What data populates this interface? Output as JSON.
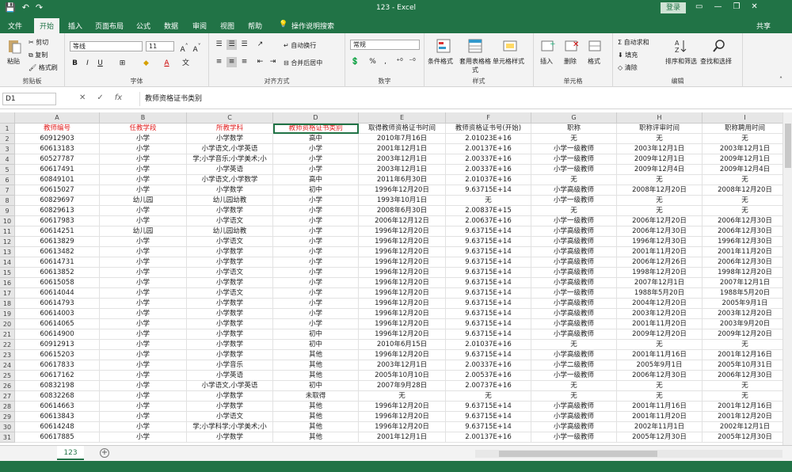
{
  "window": {
    "title": "123 - Excel",
    "login": "登录",
    "share": "共享"
  },
  "tabs": [
    "文件",
    "开始",
    "插入",
    "页面布局",
    "公式",
    "数据",
    "审阅",
    "视图",
    "帮助",
    "操作说明搜索"
  ],
  "ribbon": {
    "clipboard": {
      "paste": "粘贴",
      "cut": "剪切",
      "copy": "复制",
      "format_painter": "格式刷",
      "label": "剪贴板"
    },
    "font": {
      "name": "等线",
      "size": "11",
      "label": "字体"
    },
    "align": {
      "wrap": "自动换行",
      "merge": "合并后居中",
      "label": "对齐方式"
    },
    "number": {
      "format": "常规",
      "label": "数字"
    },
    "styles": {
      "cond": "条件格式",
      "table": "套用表格格式",
      "cell": "单元格样式",
      "label": "样式"
    },
    "cells": {
      "insert": "插入",
      "delete": "删除",
      "format": "格式",
      "label": "单元格"
    },
    "editing": {
      "autosum": "自动求和",
      "fill": "填充",
      "clear": "清除",
      "sort": "排序和筛选",
      "find": "查找和选择",
      "label": "编辑"
    }
  },
  "formula": {
    "namebox": "D1",
    "content": "教师资格证书类别"
  },
  "columns": [
    "A",
    "B",
    "C",
    "D",
    "E",
    "F",
    "G",
    "H",
    "I"
  ],
  "row_numbers": [
    "1",
    "2",
    "3",
    "4",
    "5",
    "6",
    "7",
    "8",
    "9",
    "10",
    "11",
    "12",
    "13",
    "14",
    "15",
    "16",
    "17",
    "18",
    "19",
    "20",
    "21",
    "22",
    "23",
    "24",
    "25",
    "26",
    "27",
    "28",
    "29",
    "30",
    "31"
  ],
  "rows": [
    [
      "教师编号",
      "任教学段",
      "所教学科",
      "教师资格证书类别",
      "取得教师资格证书时间",
      "教师资格证书号(开始)",
      "职称",
      "职称评审时间",
      "职称聘用时间"
    ],
    [
      "60912903",
      "小学",
      "小学数学",
      "高中",
      "2010年7月16日",
      "2.01023E+16",
      "无",
      "无",
      "无"
    ],
    [
      "60613183",
      "小学",
      "小学语文,小学英语",
      "小学",
      "2001年12月1日",
      "2.00137E+16",
      "小学一级教师",
      "2003年12月1日",
      "2003年12月1日"
    ],
    [
      "60527787",
      "小学",
      "学;小学音乐;小学美术;小",
      "小学",
      "2003年12月1日",
      "2.00337E+16",
      "小学一级教师",
      "2009年12月1日",
      "2009年12月1日"
    ],
    [
      "60617491",
      "小学",
      "小学英语",
      "小学",
      "2003年12月1日",
      "2.00337E+16",
      "小学一级教师",
      "2009年12月4日",
      "2009年12月4日"
    ],
    [
      "60849101",
      "小学",
      "小学语文,小学数学",
      "高中",
      "2011年6月30日",
      "2.01037E+16",
      "无",
      "无",
      "无"
    ],
    [
      "60615027",
      "小学",
      "小学数学",
      "初中",
      "1996年12月20日",
      "9.63715E+14",
      "小学高级教师",
      "2008年12月20日",
      "2008年12月20日"
    ],
    [
      "60829697",
      "幼儿园",
      "幼儿园幼教",
      "小学",
      "1993年10月1日",
      "无",
      "小学一级教师",
      "无",
      "无"
    ],
    [
      "60829613",
      "小学",
      "小学数学",
      "小学",
      "2008年6月30日",
      "2.00837E+15",
      "无",
      "无",
      "无"
    ],
    [
      "60617983",
      "小学",
      "小学语文",
      "小学",
      "2006年12月12日",
      "2.00637E+16",
      "小学一级教师",
      "2006年12月20日",
      "2006年12月30日"
    ],
    [
      "60614251",
      "幼儿园",
      "幼儿园幼教",
      "小学",
      "1996年12月20日",
      "9.63715E+14",
      "小学高级教师",
      "2006年12月30日",
      "2006年12月30日"
    ],
    [
      "60613829",
      "小学",
      "小学语文",
      "小学",
      "1996年12月20日",
      "9.63715E+14",
      "小学高级教师",
      "1996年12月30日",
      "1996年12月30日"
    ],
    [
      "60613482",
      "小学",
      "小学数学",
      "小学",
      "1996年12月20日",
      "9.63715E+14",
      "小学高级教师",
      "2001年11月20日",
      "2001年11月20日"
    ],
    [
      "60614731",
      "小学",
      "小学数学",
      "小学",
      "1996年12月20日",
      "9.63715E+14",
      "小学高级教师",
      "2006年12月26日",
      "2006年12月30日"
    ],
    [
      "60613852",
      "小学",
      "小学语文",
      "小学",
      "1996年12月20日",
      "9.63715E+14",
      "小学高级教师",
      "1998年12月20日",
      "1998年12月20日"
    ],
    [
      "60615058",
      "小学",
      "小学数学",
      "小学",
      "1996年12月20日",
      "9.63715E+14",
      "小学高级教师",
      "2007年12月1日",
      "2007年12月1日"
    ],
    [
      "60614044",
      "小学",
      "小学语文",
      "小学",
      "1996年12月20日",
      "9.63715E+14",
      "小学一级教师",
      "1988年5月20日",
      "1988年5月20日"
    ],
    [
      "60614793",
      "小学",
      "小学数学",
      "小学",
      "1996年12月20日",
      "9.63715E+14",
      "小学高级教师",
      "2004年12月20日",
      "2005年9月1日"
    ],
    [
      "60614003",
      "小学",
      "小学数学",
      "小学",
      "1996年12月20日",
      "9.63715E+14",
      "小学高级教师",
      "2003年12月20日",
      "2003年12月20日"
    ],
    [
      "60614065",
      "小学",
      "小学数学",
      "小学",
      "1996年12月20日",
      "9.63715E+14",
      "小学高级教师",
      "2001年11月20日",
      "2003年9月20日"
    ],
    [
      "60614900",
      "小学",
      "小学数学",
      "初中",
      "1996年12月20日",
      "9.63715E+14",
      "小学高级教师",
      "2009年12月20日",
      "2009年12月20日"
    ],
    [
      "60912913",
      "小学",
      "小学数学",
      "初中",
      "2010年6月15日",
      "2.01037E+16",
      "无",
      "无",
      "无"
    ],
    [
      "60615203",
      "小学",
      "小学数学",
      "其他",
      "1996年12月20日",
      "9.63715E+14",
      "小学高级教师",
      "2001年11月16日",
      "2001年12月16日"
    ],
    [
      "60617833",
      "小学",
      "小学音乐",
      "其他",
      "2003年12月1日",
      "2.00337E+16",
      "小学二级教师",
      "2005年9月1日",
      "2005年10月31日"
    ],
    [
      "60617162",
      "小学",
      "小学英语",
      "其他",
      "2005年10月10日",
      "2.00537E+16",
      "小学一级教师",
      "2006年12月30日",
      "2006年12月30日"
    ],
    [
      "60832198",
      "小学",
      "小学语文,小学英语",
      "初中",
      "2007年9月28日",
      "2.00737E+16",
      "无",
      "无",
      "无"
    ],
    [
      "60832268",
      "小学",
      "小学数学",
      "未取得",
      "无",
      "无",
      "无",
      "无",
      "无"
    ],
    [
      "60614663",
      "小学",
      "小学数学",
      "其他",
      "1996年12月20日",
      "9.63715E+14",
      "小学高级教师",
      "2001年11月16日",
      "2001年12月16日"
    ],
    [
      "60613843",
      "小学",
      "小学语文",
      "其他",
      "1996年12月20日",
      "9.63715E+14",
      "小学高级教师",
      "2001年11月20日",
      "2001年12月20日"
    ],
    [
      "60614248",
      "小学",
      "学;小学科学;小学美术;小",
      "其他",
      "1996年12月20日",
      "9.63715E+14",
      "小学高级教师",
      "2002年11月1日",
      "2002年12月1日"
    ],
    [
      "60617885",
      "小学",
      "小学数学",
      "其他",
      "2001年12月1日",
      "2.00137E+16",
      "小学一级教师",
      "2005年12月30日",
      "2005年12月30日"
    ]
  ],
  "red_headers": [
    0,
    1,
    2,
    3
  ],
  "sheet": {
    "name": "123",
    "add": "⊕"
  }
}
